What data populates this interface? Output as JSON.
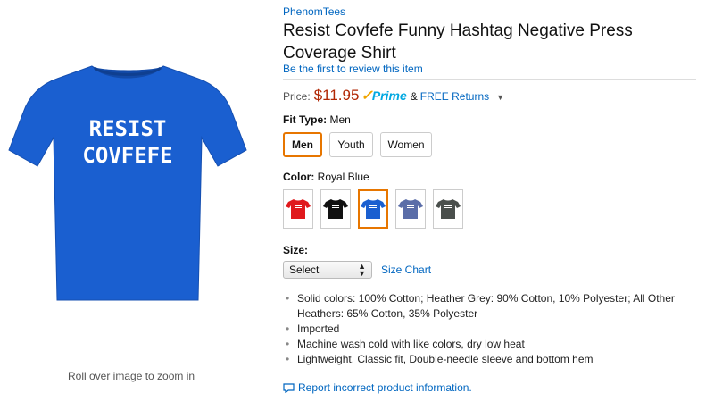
{
  "brand": "PhenomTees",
  "product_title": "Resist Covfefe Funny Hashtag Negative Press Coverage Shirt",
  "shirt_print": [
    "RESIST",
    "COVFEFE"
  ],
  "review_link": "Be the first to review this item",
  "price": {
    "label": "Price:",
    "amount": "$11.95",
    "prime": "Prime",
    "amp": "&",
    "returns": "FREE Returns",
    "caret": "▼"
  },
  "fit_type": {
    "label": "Fit Type:",
    "selected": "Men",
    "options": [
      "Men",
      "Youth",
      "Women"
    ]
  },
  "color": {
    "label": "Color:",
    "selected": "Royal Blue",
    "swatches": [
      {
        "name": "Red",
        "hex": "#e0191c"
      },
      {
        "name": "Black",
        "hex": "#111111"
      },
      {
        "name": "Royal Blue",
        "hex": "#1a5fd0"
      },
      {
        "name": "Heather Blue",
        "hex": "#5a6da8"
      },
      {
        "name": "Asphalt",
        "hex": "#4a4f4c"
      }
    ]
  },
  "size": {
    "label": "Size:",
    "select_value": "Select",
    "size_chart": "Size Chart"
  },
  "bullets": [
    "Solid colors: 100% Cotton; Heather Grey: 90% Cotton, 10% Polyester; All Other Heathers: 65% Cotton, 35% Polyester",
    "Imported",
    "Machine wash cold with like colors, dry low heat",
    "Lightweight, Classic fit, Double-needle sleeve and bottom hem"
  ],
  "zoom_hint": "Roll over image to zoom in",
  "report_link": "Report incorrect product information.",
  "colors": {
    "link": "#0066c0",
    "price": "#b12704",
    "selected_border": "#e77600",
    "shirt_main": "#1a5fd0"
  }
}
